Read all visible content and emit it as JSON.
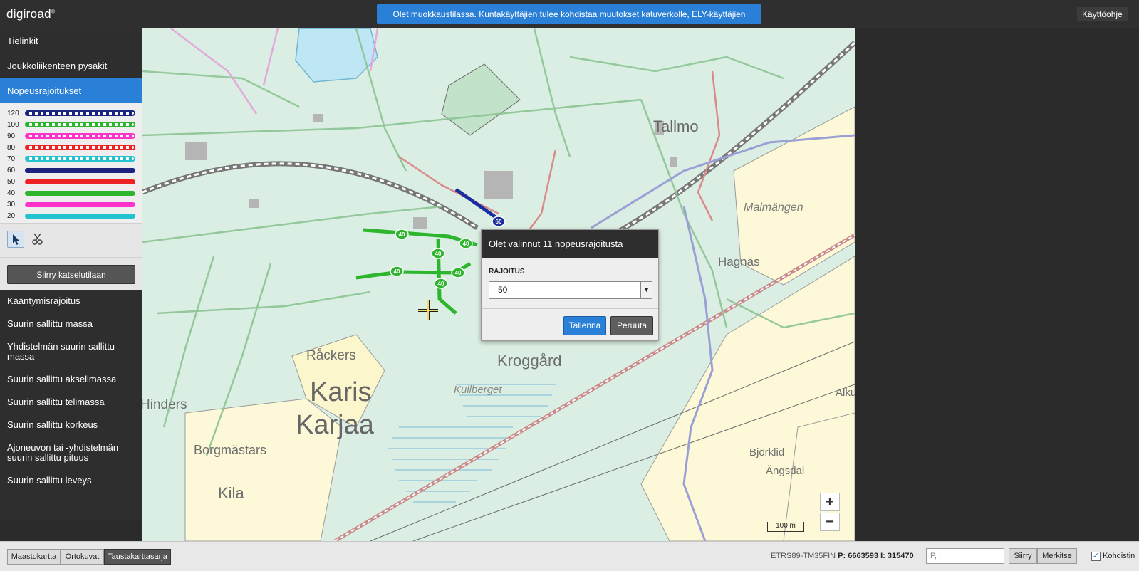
{
  "header": {
    "logo_text": "digiroad",
    "logo_mark": "®",
    "notice": "Olet muokkaustilassa. Kuntakäyttäjien tulee kohdistaa muutokset katuverkolle, ELY-käyttäjien maantieverkolle.",
    "help_label": "Käyttöohje"
  },
  "sidebar": {
    "top_items": [
      {
        "label": "Tielinkit",
        "active": false
      },
      {
        "label": "Joukkoliikenteen pysäkit",
        "active": false
      },
      {
        "label": "Nopeusrajoitukset",
        "active": true
      }
    ],
    "legend": [
      {
        "label": "120",
        "color": "#1a237e",
        "dashed": true
      },
      {
        "label": "100",
        "color": "#2db52d",
        "dashed": true
      },
      {
        "label": "90",
        "color": "#ff33cc",
        "dashed": true
      },
      {
        "label": "80",
        "color": "#ee2222",
        "dashed": true
      },
      {
        "label": "70",
        "color": "#22c3cf",
        "dashed": true
      },
      {
        "label": "60",
        "color": "#1a237e",
        "dashed": false
      },
      {
        "label": "50",
        "color": "#ee2222",
        "dashed": false
      },
      {
        "label": "40",
        "color": "#2db52d",
        "dashed": false
      },
      {
        "label": "30",
        "color": "#ff33cc",
        "dashed": false
      },
      {
        "label": "20",
        "color": "#22c3cf",
        "dashed": false
      }
    ],
    "view_mode_label": "Siirry katselutilaan",
    "lower_items": [
      "Kääntymisrajoitus",
      "Suurin sallittu massa",
      "Yhdistelmän suurin sallittu massa",
      "Suurin sallittu akselimassa",
      "Suurin sallittu telimassa",
      "Suurin sallittu korkeus",
      "Ajoneuvon tai -yhdistelmän suurin sallittu pituus",
      "Suurin sallittu leveys"
    ]
  },
  "map": {
    "place_labels": [
      "Tallmo",
      "Malmängen",
      "Hagnäs",
      "Råckers",
      "Karis",
      "Karjaa",
      "Kroggård",
      "Kullberget",
      "Hinders",
      "Borgmästars",
      "Kila",
      "Björklid",
      "Ängsdal",
      "Alku"
    ],
    "segment_speed": "40",
    "highlight_speed": "60",
    "scale_label": "100 m",
    "zoom_in": "+",
    "zoom_out": "−"
  },
  "dialog": {
    "title": "Olet valinnut 11 nopeusrajoitusta",
    "field_label": "RAJOITUS",
    "selected_value": "50",
    "save_label": "Tallenna",
    "cancel_label": "Peruuta"
  },
  "footer": {
    "layers": [
      {
        "label": "Maastokartta",
        "active": false
      },
      {
        "label": "Ortokuvat",
        "active": false
      },
      {
        "label": "Taustakarttasarja",
        "active": true
      }
    ],
    "coord_system": "ETRS89-TM35FIN",
    "p_label": "P:",
    "p_value": "6663593",
    "i_label": "I:",
    "i_value": "315470",
    "coord_placeholder": "P, I",
    "go_label": "Siirry",
    "mark_label": "Merkitse",
    "crosshair_label": "Kohdistin",
    "crosshair_checked": "✓"
  }
}
